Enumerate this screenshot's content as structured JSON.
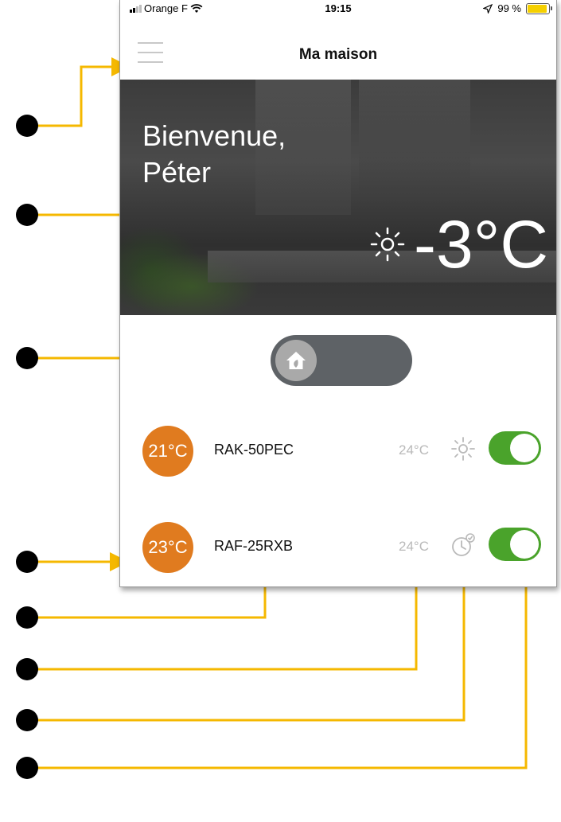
{
  "status_bar": {
    "carrier": "Orange F",
    "time": "19:15",
    "battery": "99 %"
  },
  "nav": {
    "title": "Ma maison",
    "menu_icon": "hamburger-menu-icon"
  },
  "hero": {
    "greeting_line1": "Bienvenue,",
    "greeting_line2": "Péter",
    "weather_icon": "sun-icon",
    "outdoor_temp": "-3°C"
  },
  "mode_toggle": {
    "icon": "home-eco-icon",
    "state": "off"
  },
  "devices": [
    {
      "room_temp": "21°C",
      "name": "RAK-50PEC",
      "set_temp": "24°C",
      "mode_icon": "sun-icon",
      "power": "on"
    },
    {
      "room_temp": "23°C",
      "name": "RAF-25RXB",
      "set_temp": "24°C",
      "mode_icon": "timer-icon",
      "power": "on"
    }
  ],
  "colors": {
    "accent_orange": "#e07b1f",
    "switch_green": "#4aa32b",
    "toggle_grey": "#5e6266",
    "annotation_yellow": "#f5b800"
  }
}
